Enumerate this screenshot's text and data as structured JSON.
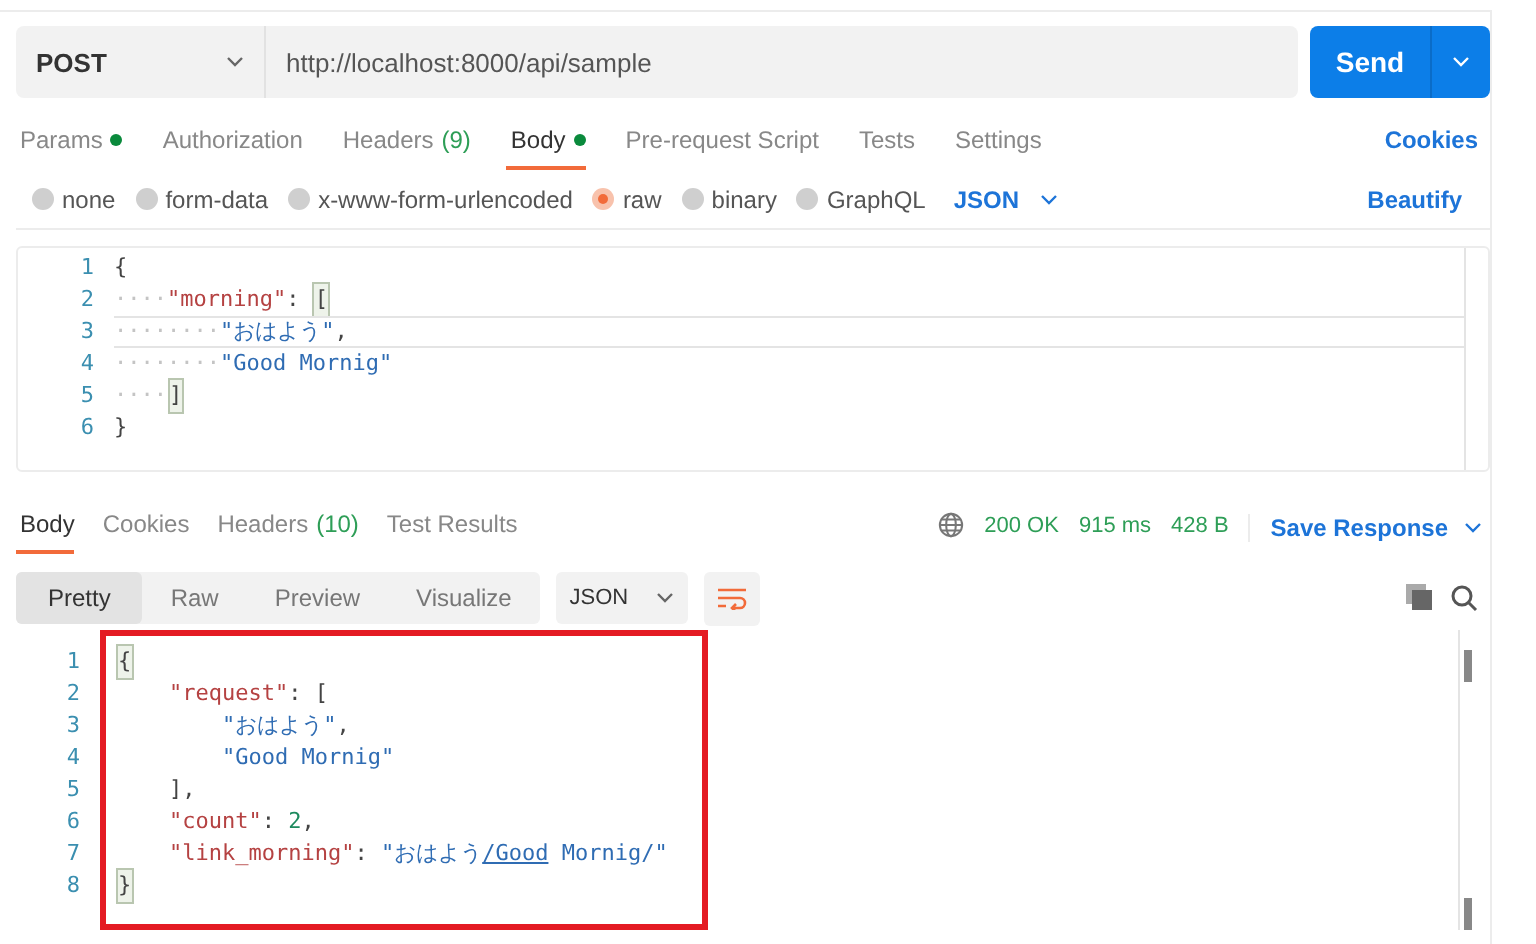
{
  "request_bar": {
    "method": "POST",
    "url": "http://localhost:8000/api/sample",
    "send": "Send"
  },
  "request_tabs": [
    {
      "label": "Params",
      "dot": true,
      "selected": false
    },
    {
      "label": "Authorization",
      "dot": false,
      "selected": false
    },
    {
      "label": "Headers",
      "count": "(9)",
      "dot": false,
      "selected": false
    },
    {
      "label": "Body",
      "dot": true,
      "selected": true
    },
    {
      "label": "Pre-request Script",
      "dot": false,
      "selected": false
    },
    {
      "label": "Tests",
      "dot": false,
      "selected": false
    },
    {
      "label": "Settings",
      "dot": false,
      "selected": false
    }
  ],
  "cookies_link": "Cookies",
  "body_types": [
    {
      "label": "none",
      "selected": false
    },
    {
      "label": "form-data",
      "selected": false
    },
    {
      "label": "x-www-form-urlencoded",
      "selected": false
    },
    {
      "label": "raw",
      "selected": true
    },
    {
      "label": "binary",
      "selected": false
    },
    {
      "label": "GraphQL",
      "selected": false
    }
  ],
  "body_format": "JSON",
  "beautify": "Beautify",
  "request_editor": [
    {
      "number": "1",
      "current": false,
      "tokens": [
        {
          "kind": "punct",
          "text": "{"
        }
      ]
    },
    {
      "number": "2",
      "current": false,
      "tokens": [
        {
          "kind": "ws",
          "text": "····"
        },
        {
          "kind": "key",
          "text": "\"morning\""
        },
        {
          "kind": "punct",
          "text": ": "
        },
        {
          "kind": "match",
          "text": "["
        }
      ]
    },
    {
      "number": "3",
      "current": true,
      "tokens": [
        {
          "kind": "ws",
          "text": "········"
        },
        {
          "kind": "string",
          "text": "\"おはよう\""
        },
        {
          "kind": "punct",
          "text": ","
        }
      ]
    },
    {
      "number": "4",
      "current": false,
      "tokens": [
        {
          "kind": "ws",
          "text": "········"
        },
        {
          "kind": "string",
          "text": "\"Good Mornig\""
        }
      ]
    },
    {
      "number": "5",
      "current": false,
      "tokens": [
        {
          "kind": "ws",
          "text": "····"
        },
        {
          "kind": "match",
          "text": "]"
        }
      ]
    },
    {
      "number": "6",
      "current": false,
      "tokens": [
        {
          "kind": "punct",
          "text": "}"
        }
      ]
    }
  ],
  "response_tabs": [
    {
      "label": "Body",
      "selected": true
    },
    {
      "label": "Cookies",
      "selected": false
    },
    {
      "label": "Headers",
      "count": "(10)",
      "selected": false
    },
    {
      "label": "Test Results",
      "selected": false
    }
  ],
  "status": {
    "code": "200 OK",
    "time": "915 ms",
    "size": "428 B"
  },
  "save_response": "Save Response",
  "view_modes": [
    {
      "label": "Pretty",
      "selected": true
    },
    {
      "label": "Raw",
      "selected": false
    },
    {
      "label": "Preview",
      "selected": false
    },
    {
      "label": "Visualize",
      "selected": false
    }
  ],
  "response_format": "JSON",
  "response_editor": [
    {
      "number": "1",
      "tokens": [
        {
          "kind": "match",
          "text": "{"
        }
      ]
    },
    {
      "number": "2",
      "tokens": [
        {
          "kind": "key",
          "text": "    \"request\""
        },
        {
          "kind": "punct",
          "text": ": ["
        }
      ]
    },
    {
      "number": "3",
      "tokens": [
        {
          "kind": "string",
          "text": "        \"おはよう\""
        },
        {
          "kind": "punct",
          "text": ","
        }
      ]
    },
    {
      "number": "4",
      "tokens": [
        {
          "kind": "string",
          "text": "        \"Good Mornig\""
        }
      ]
    },
    {
      "number": "5",
      "tokens": [
        {
          "kind": "punct",
          "text": "    ],"
        }
      ]
    },
    {
      "number": "6",
      "tokens": [
        {
          "kind": "key",
          "text": "    \"count\""
        },
        {
          "kind": "punct",
          "text": ": "
        },
        {
          "kind": "number",
          "text": "2"
        },
        {
          "kind": "punct",
          "text": ","
        }
      ]
    },
    {
      "number": "7",
      "tokens": [
        {
          "kind": "key",
          "text": "    \"link_morning\""
        },
        {
          "kind": "punct",
          "text": ": "
        },
        {
          "kind": "string",
          "text": "\"おはよう"
        },
        {
          "kind": "link",
          "text": "/Good"
        },
        {
          "kind": "string",
          "text": " Mornig/\""
        }
      ]
    },
    {
      "number": "8",
      "tokens": [
        {
          "kind": "match",
          "text": "}"
        }
      ]
    }
  ]
}
